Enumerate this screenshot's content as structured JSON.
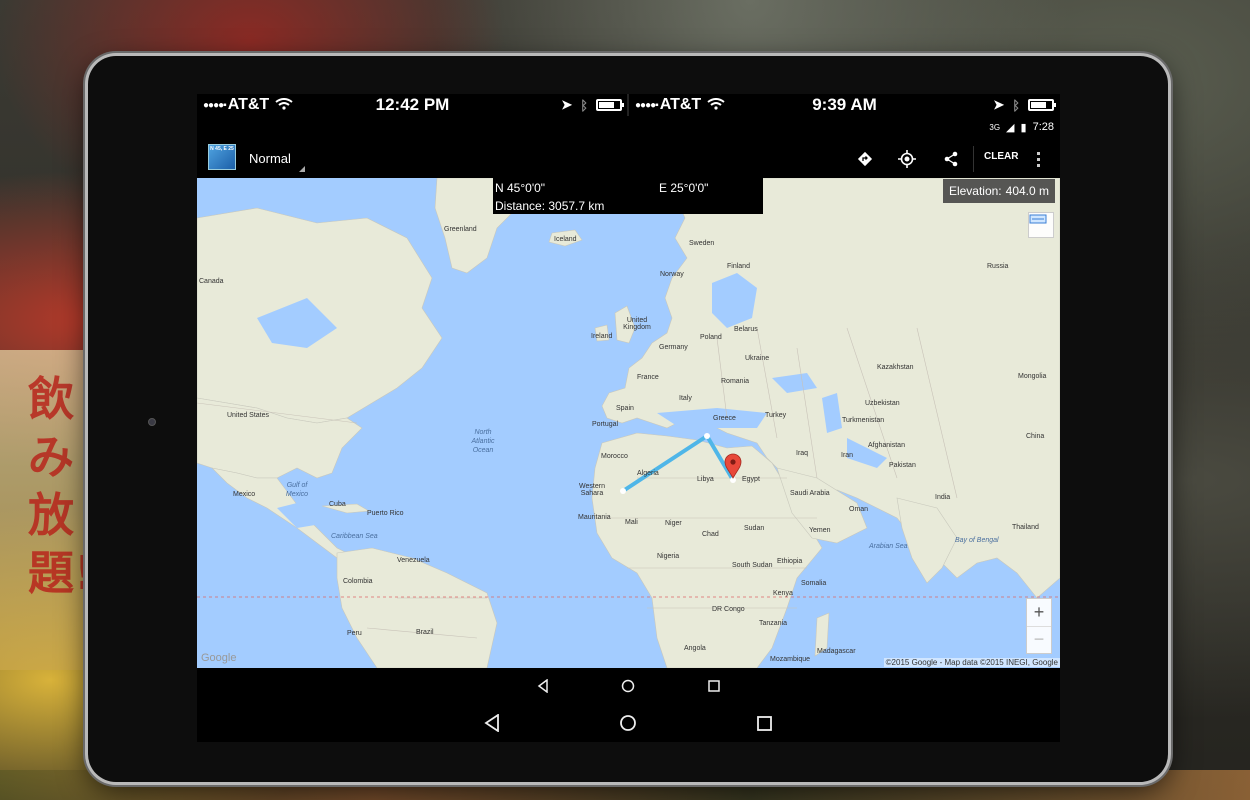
{
  "ios_left": {
    "carrier": "AT&T",
    "time": "12:42 PM"
  },
  "ios_right": {
    "carrier": "AT&T",
    "time": "9:39 AM"
  },
  "android_status": {
    "network": "3G",
    "time": "7:28"
  },
  "toolbar": {
    "logo_text": "N 45, E 25",
    "map_mode": "Normal",
    "directions_icon": "directions-icon",
    "locate_icon": "my-location-icon",
    "share_icon": "share-icon",
    "clear_label": "CLEAR",
    "overflow_icon": "overflow-menu-icon"
  },
  "info": {
    "latitude": "N 45°0'0\"",
    "longitude": "E 25°0'0\"",
    "distance": "Distance: 3057.7 km"
  },
  "elevation": {
    "label": "Elevation:",
    "value": "404.0 m"
  },
  "map": {
    "countries": [
      "Greenland",
      "Iceland",
      "Sweden",
      "Finland",
      "Norway",
      "Russia",
      "Canada",
      "United Kingdom",
      "Ireland",
      "Poland",
      "Belarus",
      "Germany",
      "Ukraine",
      "France",
      "Romania",
      "Kazakhstan",
      "Mongolia",
      "Italy",
      "Spain",
      "Portugal",
      "Uzbekistan",
      "Turkmenistan",
      "Greece",
      "Turkey",
      "China",
      "United States",
      "Iraq",
      "Iran",
      "Afghanistan",
      "Pakistan",
      "Morocco",
      "Algeria",
      "Libya",
      "Egypt",
      "Saudi Arabia",
      "India",
      "Western Sahara",
      "Mexico",
      "Cuba",
      "Puerto Rico",
      "Mauritania",
      "Mali",
      "Niger",
      "Chad",
      "Sudan",
      "Oman",
      "Thailand",
      "Yemen",
      "Nigeria",
      "Ethiopia",
      "South Sudan",
      "Venezuela",
      "Colombia",
      "Kenya",
      "DR Congo",
      "Somalia",
      "Tanzania",
      "Angola",
      "Brazil",
      "Peru",
      "Mozambique",
      "Madagascar"
    ],
    "oceans": [
      "North Atlantic Ocean",
      "Gulf of Mexico",
      "Caribbean Sea",
      "Arabian Sea",
      "Bay of Bengal"
    ],
    "zoom_in": "+",
    "zoom_out": "−",
    "watermark": "Google",
    "attribution": "©2015 Google - Map data ©2015 INEGI, Google",
    "layers_icon": "layers-icon",
    "marker_icon": "map-pin-icon"
  },
  "nav": {
    "back_icon": "back-icon",
    "home_icon": "home-icon",
    "recents_icon": "recents-icon"
  },
  "background": {
    "sign_text": "飲み放題!!"
  }
}
